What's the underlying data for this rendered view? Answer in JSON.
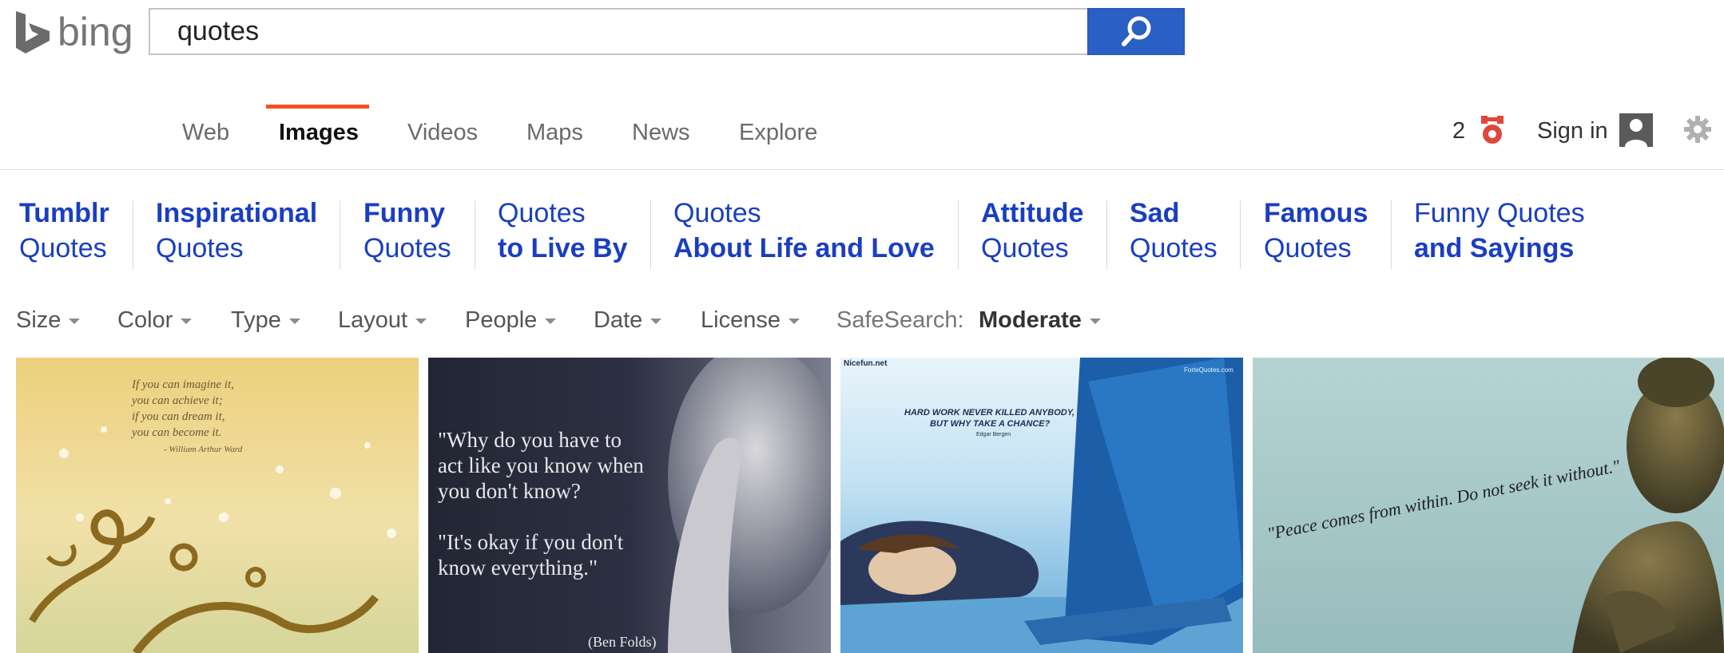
{
  "brand": {
    "logo_text": "bing"
  },
  "search": {
    "query": "quotes"
  },
  "nav": {
    "tabs": [
      {
        "label": "Web"
      },
      {
        "label": "Images",
        "active": true
      },
      {
        "label": "Videos"
      },
      {
        "label": "Maps"
      },
      {
        "label": "News"
      },
      {
        "label": "Explore"
      }
    ]
  },
  "account": {
    "rewards_count": "2",
    "signin_label": "Sign in"
  },
  "related": [
    {
      "line1": "Tumblr",
      "line2": "Quotes"
    },
    {
      "line1": "Inspirational",
      "line2": "Quotes"
    },
    {
      "line1": "Funny",
      "line2": "Quotes"
    },
    {
      "line1": "Quotes",
      "line2": "to Live By"
    },
    {
      "line1": "Quotes",
      "line2": "About Life and Love"
    },
    {
      "line1": "Attitude",
      "line2": "Quotes"
    },
    {
      "line1": "Sad",
      "line2": "Quotes"
    },
    {
      "line1": "Famous",
      "line2": "Quotes"
    },
    {
      "line1": "Funny Quotes",
      "line2": "and Sayings"
    }
  ],
  "filters": {
    "size": "Size",
    "color": "Color",
    "type": "Type",
    "layout": "Layout",
    "people": "People",
    "date": "Date",
    "license": "License",
    "safesearch_label": "SafeSearch:",
    "safesearch_value": "Moderate"
  },
  "images": [
    {
      "lines": [
        "If you can imagine it,",
        "you can achieve it;",
        "if you can dream it,",
        "you can become it."
      ],
      "author": "- William Arthur Ward"
    },
    {
      "lines": [
        "\"Why do you have to",
        "act like you know when",
        "you don't know?",
        "\"It's okay if you don't",
        "know everything.\""
      ],
      "author": "(Ben Folds)"
    },
    {
      "site": "Nicefun.net",
      "site2": "ForteQuotes.com",
      "lines": [
        "HARD WORK NEVER KILLED ANYBODY,",
        "BUT WHY TAKE A CHANCE?"
      ],
      "author": "Edgar Bergen"
    },
    {
      "lines": [
        "\"Peace comes from within. Do not seek it without.\""
      ]
    }
  ],
  "colors": {
    "accent": "#f25022",
    "link": "#1a3ec2",
    "search_button": "#2a5fc4"
  }
}
